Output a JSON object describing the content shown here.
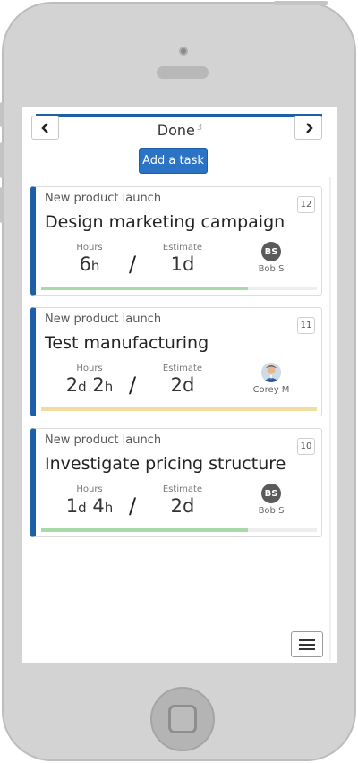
{
  "header": {
    "column_title": "Done",
    "column_count": "3",
    "prev_icon": "chevron-left-icon",
    "next_icon": "chevron-right-icon",
    "add_task_label": "Add a task"
  },
  "labels": {
    "hours": "Hours",
    "estimate": "Estimate",
    "separator": "/"
  },
  "colors": {
    "accent": "#1f5fa8",
    "button": "#2a73c5",
    "progress_green": "#a8d9a8",
    "progress_yellow": "#f1dda0"
  },
  "cards": [
    {
      "project": "New product launch",
      "title": "Design marketing campaign",
      "number": "12",
      "hours": [
        {
          "n": "6",
          "u": "h"
        }
      ],
      "estimate": "1d",
      "assignee_initials": "BS",
      "assignee_name": "Bob S",
      "progress": 0.75,
      "progress_color": "green"
    },
    {
      "project": "New product launch",
      "title": "Test manufacturing",
      "number": "11",
      "hours": [
        {
          "n": "2",
          "u": "d"
        },
        {
          "n": "2",
          "u": "h"
        }
      ],
      "estimate": "2d",
      "assignee_initials": "",
      "assignee_name": "Corey M",
      "progress": 1.0,
      "progress_color": "yellow"
    },
    {
      "project": "New product launch",
      "title": "Investigate pricing structure",
      "number": "10",
      "hours": [
        {
          "n": "1",
          "u": "d"
        },
        {
          "n": "4",
          "u": "h"
        }
      ],
      "estimate": "2d",
      "assignee_initials": "BS",
      "assignee_name": "Bob S",
      "progress": 0.75,
      "progress_color": "green"
    }
  ],
  "footer": {
    "menu_icon": "hamburger-menu-icon"
  }
}
